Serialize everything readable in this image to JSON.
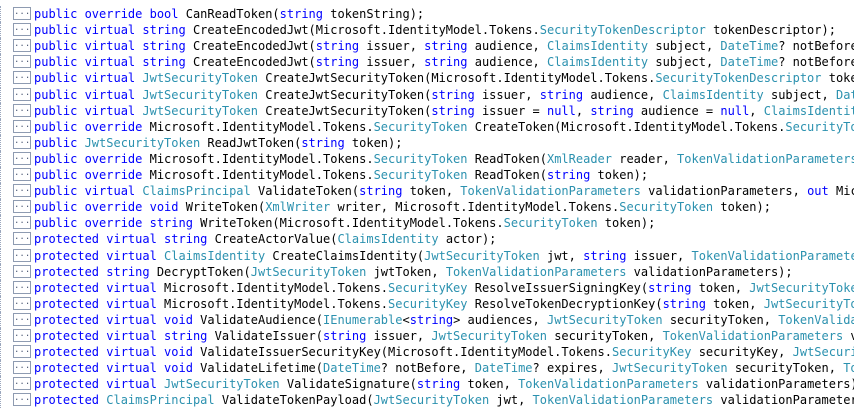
{
  "colors": {
    "keyword": "#0000ff",
    "type": "#2b91af",
    "text": "#000000",
    "toggle_border": "#8e9bb1"
  },
  "toggle_icon": "ellipsis-box-icon",
  "toggle_glyph": "...",
  "lines": [
    [
      [
        "k",
        "public override bool"
      ],
      [
        "p",
        " CanReadToken("
      ],
      [
        "k",
        "string"
      ],
      [
        "p",
        " tokenString);"
      ]
    ],
    [
      [
        "k",
        "public virtual string"
      ],
      [
        "p",
        " CreateEncodedJwt(Microsoft.IdentityModel.Tokens."
      ],
      [
        "t",
        "SecurityTokenDescriptor"
      ],
      [
        "p",
        " tokenDescriptor);"
      ]
    ],
    [
      [
        "k",
        "public virtual string"
      ],
      [
        "p",
        " CreateEncodedJwt("
      ],
      [
        "k",
        "string"
      ],
      [
        "p",
        " issuer, "
      ],
      [
        "k",
        "string"
      ],
      [
        "p",
        " audience, "
      ],
      [
        "t",
        "ClaimsIdentity"
      ],
      [
        "p",
        " subject, "
      ],
      [
        "t",
        "DateTime"
      ],
      [
        "p",
        "? notBefore, D"
      ]
    ],
    [
      [
        "k",
        "public virtual string"
      ],
      [
        "p",
        " CreateEncodedJwt("
      ],
      [
        "k",
        "string"
      ],
      [
        "p",
        " issuer, "
      ],
      [
        "k",
        "string"
      ],
      [
        "p",
        " audience, "
      ],
      [
        "t",
        "ClaimsIdentity"
      ],
      [
        "p",
        " subject, "
      ],
      [
        "t",
        "DateTime"
      ],
      [
        "p",
        "? notBefore, D"
      ]
    ],
    [
      [
        "k",
        "public virtual "
      ],
      [
        "t",
        "JwtSecurityToken"
      ],
      [
        "p",
        " CreateJwtSecurityToken(Microsoft.IdentityModel.Tokens."
      ],
      [
        "t",
        "SecurityTokenDescriptor"
      ],
      [
        "p",
        " tokenDe"
      ]
    ],
    [
      [
        "k",
        "public virtual "
      ],
      [
        "t",
        "JwtSecurityToken"
      ],
      [
        "p",
        " CreateJwtSecurityToken("
      ],
      [
        "k",
        "string"
      ],
      [
        "p",
        " issuer, "
      ],
      [
        "k",
        "string"
      ],
      [
        "p",
        " audience, "
      ],
      [
        "t",
        "ClaimsIdentity"
      ],
      [
        "p",
        " subject, "
      ],
      [
        "t",
        "DateTi"
      ]
    ],
    [
      [
        "k",
        "public virtual "
      ],
      [
        "t",
        "JwtSecurityToken"
      ],
      [
        "p",
        " CreateJwtSecurityToken("
      ],
      [
        "k",
        "string"
      ],
      [
        "p",
        " issuer = "
      ],
      [
        "k",
        "null"
      ],
      [
        "p",
        ", "
      ],
      [
        "k",
        "string"
      ],
      [
        "p",
        " audience = "
      ],
      [
        "k",
        "null"
      ],
      [
        "p",
        ", "
      ],
      [
        "t",
        "ClaimsIdentity"
      ],
      [
        "p",
        " s"
      ]
    ],
    [
      [
        "k",
        "public override"
      ],
      [
        "p",
        " Microsoft.IdentityModel.Tokens."
      ],
      [
        "t",
        "SecurityToken"
      ],
      [
        "p",
        " CreateToken(Microsoft.IdentityModel.Tokens."
      ],
      [
        "t",
        "SecurityToken"
      ]
    ],
    [
      [
        "k",
        "public "
      ],
      [
        "t",
        "JwtSecurityToken"
      ],
      [
        "p",
        " ReadJwtToken("
      ],
      [
        "k",
        "string"
      ],
      [
        "p",
        " token);"
      ]
    ],
    [
      [
        "k",
        "public override"
      ],
      [
        "p",
        " Microsoft.IdentityModel.Tokens."
      ],
      [
        "t",
        "SecurityToken"
      ],
      [
        "p",
        " ReadToken("
      ],
      [
        "t",
        "XmlReader"
      ],
      [
        "p",
        " reader, "
      ],
      [
        "t",
        "TokenValidationParameters"
      ],
      [
        "p",
        " va"
      ]
    ],
    [
      [
        "k",
        "public override"
      ],
      [
        "p",
        " Microsoft.IdentityModel.Tokens."
      ],
      [
        "t",
        "SecurityToken"
      ],
      [
        "p",
        " ReadToken("
      ],
      [
        "k",
        "string"
      ],
      [
        "p",
        " token);"
      ]
    ],
    [
      [
        "k",
        "public virtual "
      ],
      [
        "t",
        "ClaimsPrincipal"
      ],
      [
        "p",
        " ValidateToken("
      ],
      [
        "k",
        "string"
      ],
      [
        "p",
        " token, "
      ],
      [
        "t",
        "TokenValidationParameters"
      ],
      [
        "p",
        " validationParameters, "
      ],
      [
        "k",
        "out"
      ],
      [
        "p",
        " Micros"
      ]
    ],
    [
      [
        "k",
        "public override void"
      ],
      [
        "p",
        " WriteToken("
      ],
      [
        "t",
        "XmlWriter"
      ],
      [
        "p",
        " writer, Microsoft.IdentityModel.Tokens."
      ],
      [
        "t",
        "SecurityToken"
      ],
      [
        "p",
        " token);"
      ]
    ],
    [
      [
        "k",
        "public override string"
      ],
      [
        "p",
        " WriteToken(Microsoft.IdentityModel.Tokens."
      ],
      [
        "t",
        "SecurityToken"
      ],
      [
        "p",
        " token);"
      ]
    ],
    [
      [
        "k",
        "protected virtual string"
      ],
      [
        "p",
        " CreateActorValue("
      ],
      [
        "t",
        "ClaimsIdentity"
      ],
      [
        "p",
        " actor);"
      ]
    ],
    [
      [
        "k",
        "protected virtual "
      ],
      [
        "t",
        "ClaimsIdentity"
      ],
      [
        "p",
        " CreateClaimsIdentity("
      ],
      [
        "t",
        "JwtSecurityToken"
      ],
      [
        "p",
        " jwt, "
      ],
      [
        "k",
        "string"
      ],
      [
        "p",
        " issuer, "
      ],
      [
        "t",
        "TokenValidationParameters"
      ]
    ],
    [
      [
        "k",
        "protected string"
      ],
      [
        "p",
        " DecryptToken("
      ],
      [
        "t",
        "JwtSecurityToken"
      ],
      [
        "p",
        " jwtToken, "
      ],
      [
        "t",
        "TokenValidationParameters"
      ],
      [
        "p",
        " validationParameters);"
      ]
    ],
    [
      [
        "k",
        "protected virtual"
      ],
      [
        "p",
        " Microsoft.IdentityModel.Tokens."
      ],
      [
        "t",
        "SecurityKey"
      ],
      [
        "p",
        " ResolveIssuerSigningKey("
      ],
      [
        "k",
        "string"
      ],
      [
        "p",
        " token, "
      ],
      [
        "t",
        "JwtSecurityToken"
      ],
      [
        "p",
        " j"
      ]
    ],
    [
      [
        "k",
        "protected virtual"
      ],
      [
        "p",
        " Microsoft.IdentityModel.Tokens."
      ],
      [
        "t",
        "SecurityKey"
      ],
      [
        "p",
        " ResolveTokenDecryptionKey("
      ],
      [
        "k",
        "string"
      ],
      [
        "p",
        " token, "
      ],
      [
        "t",
        "JwtSecurityToken"
      ]
    ],
    [
      [
        "k",
        "protected virtual void"
      ],
      [
        "p",
        " ValidateAudience("
      ],
      [
        "t",
        "IEnumerable"
      ],
      [
        "p",
        "<"
      ],
      [
        "k",
        "string"
      ],
      [
        "p",
        "> audiences, "
      ],
      [
        "t",
        "JwtSecurityToken"
      ],
      [
        "p",
        " securityToken, "
      ],
      [
        "t",
        "TokenValidatio"
      ]
    ],
    [
      [
        "k",
        "protected virtual string"
      ],
      [
        "p",
        " ValidateIssuer("
      ],
      [
        "k",
        "string"
      ],
      [
        "p",
        " issuer, "
      ],
      [
        "t",
        "JwtSecurityToken"
      ],
      [
        "p",
        " securityToken, "
      ],
      [
        "t",
        "TokenValidationParameters"
      ],
      [
        "p",
        " vali"
      ]
    ],
    [
      [
        "k",
        "protected virtual void"
      ],
      [
        "p",
        " ValidateIssuerSecurityKey(Microsoft.IdentityModel.Tokens."
      ],
      [
        "t",
        "SecurityKey"
      ],
      [
        "p",
        " securityKey, "
      ],
      [
        "t",
        "JwtSecurityT"
      ]
    ],
    [
      [
        "k",
        "protected virtual void"
      ],
      [
        "p",
        " ValidateLifetime("
      ],
      [
        "t",
        "DateTime"
      ],
      [
        "p",
        "? notBefore, "
      ],
      [
        "t",
        "DateTime"
      ],
      [
        "p",
        "? expires, "
      ],
      [
        "t",
        "JwtSecurityToken"
      ],
      [
        "p",
        " securityToken, "
      ],
      [
        "t",
        "Tok"
      ]
    ],
    [
      [
        "k",
        "protected virtual "
      ],
      [
        "t",
        "JwtSecurityToken"
      ],
      [
        "p",
        " ValidateSignature("
      ],
      [
        "k",
        "string"
      ],
      [
        "p",
        " token, "
      ],
      [
        "t",
        "TokenValidationParameters"
      ],
      [
        "p",
        " validationParameters);"
      ]
    ],
    [
      [
        "k",
        "protected "
      ],
      [
        "t",
        "ClaimsPrincipal"
      ],
      [
        "p",
        " ValidateTokenPayload("
      ],
      [
        "t",
        "JwtSecurityToken"
      ],
      [
        "p",
        " jwt, "
      ],
      [
        "t",
        "TokenValidationParameters"
      ],
      [
        "p",
        " validationParameters);"
      ]
    ]
  ]
}
